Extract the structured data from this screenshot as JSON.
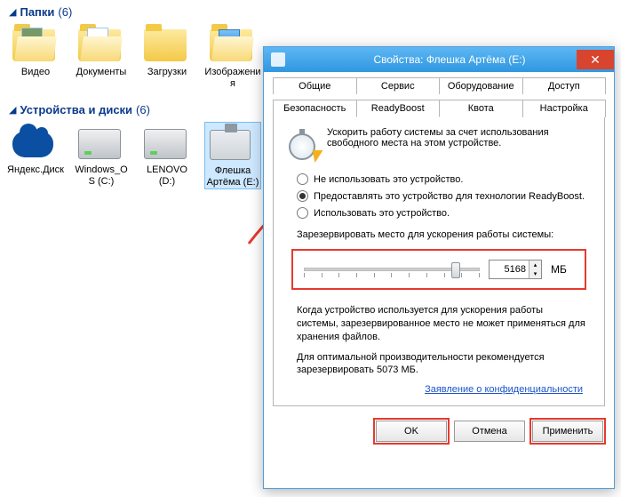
{
  "explorer": {
    "folders_header": "Папки",
    "folders_count": "(6)",
    "folders": [
      {
        "label": "Видео"
      },
      {
        "label": "Документы"
      },
      {
        "label": "Загрузки"
      },
      {
        "label": "Изображения"
      }
    ],
    "drives_header": "Устройства и диски",
    "drives_count": "(6)",
    "drives": [
      {
        "label": "Яндекс.Диск"
      },
      {
        "label": "Windows_OS (C:)"
      },
      {
        "label": "LENOVO (D:)"
      },
      {
        "label": "Флешка Артёма (E:)"
      }
    ]
  },
  "dialog": {
    "title": "Свойства: Флешка Артёма (E:)",
    "tabs_row1": [
      "Общие",
      "Сервис",
      "Оборудование",
      "Доступ"
    ],
    "tabs_row2": [
      "Безопасность",
      "ReadyBoost",
      "Квота",
      "Настройка"
    ],
    "active_tab": "ReadyBoost",
    "intro": "Ускорить работу системы за счет использования свободного места на этом устройстве.",
    "radio1": "Не использовать это устройство.",
    "radio2": "Предоставлять это устройство для технологии ReadyBoost.",
    "radio3": "Использовать это устройство.",
    "selected_radio": 2,
    "reserve_label": "Зарезервировать место для ускорения работы системы:",
    "slider": {
      "min": 0,
      "max": 5200,
      "value": 5168,
      "thumb_pct": 84,
      "unit": "МБ"
    },
    "note1": "Когда устройство используется для ускорения работы системы, зарезервированное место не может применяться для хранения файлов.",
    "note2": "Для оптимальной производительности рекомендуется зарезервировать 5073 МБ.",
    "privacy_link": "Заявление о конфиденциальности",
    "buttons": {
      "ok": "OK",
      "cancel": "Отмена",
      "apply": "Применить"
    }
  }
}
